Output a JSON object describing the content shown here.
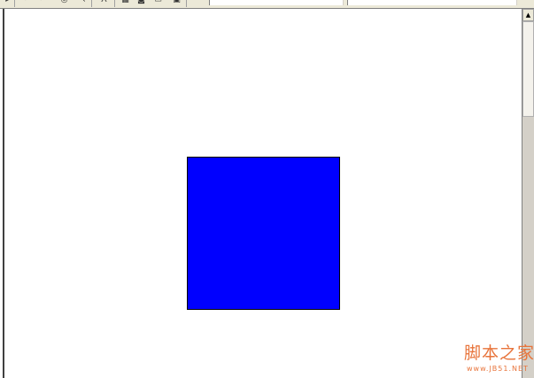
{
  "toolbar": {
    "icons": [
      "play-icon",
      "undo-icon",
      "redo-icon",
      "zoom-icon",
      "select-icon",
      "text-icon",
      "grid-icon",
      "camera-icon",
      "folder-icon",
      "save-icon"
    ],
    "field_text": "· · · · ·",
    "field2_text": "· · · · · · ·"
  },
  "canvas": {
    "shape": "square",
    "fill_color": "#0000ff",
    "stroke_color": "#000000"
  },
  "colors": {
    "background": "#ffffff",
    "toolbar": "#ece9d8",
    "scrollbar": "#d4d0c8",
    "watermark": "#e8743b"
  },
  "watermark": {
    "cn": "脚本之家",
    "en": "www.JB51.NET"
  }
}
